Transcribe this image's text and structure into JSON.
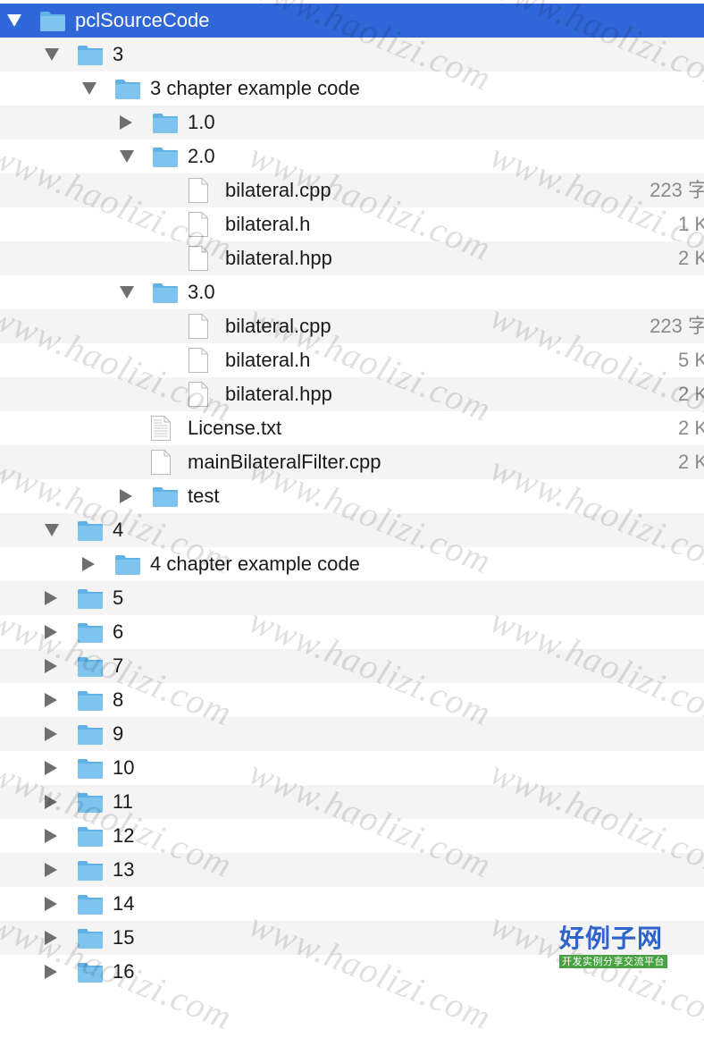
{
  "finder_tree": {
    "rows": [
      {
        "level": 0,
        "kind": "folder",
        "expanded": true,
        "selected": true,
        "name": "pclSourceCode",
        "size": ""
      },
      {
        "level": 1,
        "kind": "folder",
        "expanded": true,
        "selected": false,
        "name": "3",
        "size": ""
      },
      {
        "level": 2,
        "kind": "folder",
        "expanded": true,
        "selected": false,
        "name": "3 chapter example code",
        "size": ""
      },
      {
        "level": 3,
        "kind": "folder",
        "expanded": false,
        "selected": false,
        "name": "1.0",
        "size": ""
      },
      {
        "level": 3,
        "kind": "folder",
        "expanded": true,
        "selected": false,
        "name": "2.0",
        "size": ""
      },
      {
        "level": 4,
        "kind": "file",
        "expanded": null,
        "selected": false,
        "name": "bilateral.cpp",
        "size": "223 字"
      },
      {
        "level": 4,
        "kind": "file",
        "expanded": null,
        "selected": false,
        "name": "bilateral.h",
        "size": "1 K"
      },
      {
        "level": 4,
        "kind": "file",
        "expanded": null,
        "selected": false,
        "name": "bilateral.hpp",
        "size": "2 K"
      },
      {
        "level": 3,
        "kind": "folder",
        "expanded": true,
        "selected": false,
        "name": "3.0",
        "size": ""
      },
      {
        "level": 4,
        "kind": "file",
        "expanded": null,
        "selected": false,
        "name": "bilateral.cpp",
        "size": "223 字"
      },
      {
        "level": 4,
        "kind": "file",
        "expanded": null,
        "selected": false,
        "name": "bilateral.h",
        "size": "5 K"
      },
      {
        "level": 4,
        "kind": "file",
        "expanded": null,
        "selected": false,
        "name": "bilateral.hpp",
        "size": "2 K"
      },
      {
        "level": 3,
        "kind": "text",
        "expanded": null,
        "selected": false,
        "name": "License.txt",
        "size": "2 K"
      },
      {
        "level": 3,
        "kind": "file",
        "expanded": null,
        "selected": false,
        "name": "mainBilateralFilter.cpp",
        "size": "2 K"
      },
      {
        "level": 3,
        "kind": "folder",
        "expanded": false,
        "selected": false,
        "name": "test",
        "size": ""
      },
      {
        "level": 1,
        "kind": "folder",
        "expanded": true,
        "selected": false,
        "name": "4",
        "size": ""
      },
      {
        "level": 2,
        "kind": "folder",
        "expanded": false,
        "selected": false,
        "name": "4 chapter example code",
        "size": ""
      },
      {
        "level": 1,
        "kind": "folder",
        "expanded": false,
        "selected": false,
        "name": "5",
        "size": ""
      },
      {
        "level": 1,
        "kind": "folder",
        "expanded": false,
        "selected": false,
        "name": "6",
        "size": ""
      },
      {
        "level": 1,
        "kind": "folder",
        "expanded": false,
        "selected": false,
        "name": "7",
        "size": ""
      },
      {
        "level": 1,
        "kind": "folder",
        "expanded": false,
        "selected": false,
        "name": "8",
        "size": ""
      },
      {
        "level": 1,
        "kind": "folder",
        "expanded": false,
        "selected": false,
        "name": "9",
        "size": ""
      },
      {
        "level": 1,
        "kind": "folder",
        "expanded": false,
        "selected": false,
        "name": "10",
        "size": ""
      },
      {
        "level": 1,
        "kind": "folder",
        "expanded": false,
        "selected": false,
        "name": "11",
        "size": ""
      },
      {
        "level": 1,
        "kind": "folder",
        "expanded": false,
        "selected": false,
        "name": "12",
        "size": ""
      },
      {
        "level": 1,
        "kind": "folder",
        "expanded": false,
        "selected": false,
        "name": "13",
        "size": ""
      },
      {
        "level": 1,
        "kind": "folder",
        "expanded": false,
        "selected": false,
        "name": "14",
        "size": ""
      },
      {
        "level": 1,
        "kind": "folder",
        "expanded": false,
        "selected": false,
        "name": "15",
        "size": ""
      },
      {
        "level": 1,
        "kind": "folder",
        "expanded": false,
        "selected": false,
        "name": "16",
        "size": ""
      }
    ]
  },
  "icons": {
    "disclosure_open": "disclosure-triangle-down-icon",
    "disclosure_closed": "disclosure-triangle-right-icon",
    "folder": "folder-icon",
    "file": "document-icon",
    "text_file": "text-document-icon"
  },
  "colors": {
    "selection": "#2f67d8",
    "alt_row": "#f4f4f5",
    "folder_fill": "#7ec4ee",
    "folder_tab": "#5fb1e6",
    "size_text": "#8a8a8a"
  },
  "watermark": {
    "text": "www.haolizi.com"
  },
  "logo": {
    "title": "好例子网",
    "subtitle": "开发实例分享交流平台"
  }
}
